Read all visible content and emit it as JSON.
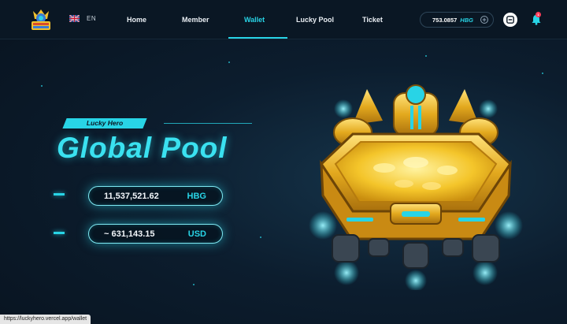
{
  "nav": {
    "language": {
      "label": "EN",
      "flag_icon": "uk-flag-icon"
    },
    "links": [
      {
        "label": "Home",
        "active": false
      },
      {
        "label": "Member",
        "active": false
      },
      {
        "label": "Wallet",
        "active": true
      },
      {
        "label": "Lucky Pool",
        "active": false
      },
      {
        "label": "Ticket",
        "active": false
      }
    ],
    "balance": {
      "amount": "753.0857",
      "unit": "HBG",
      "add_icon": "plus-circle-icon"
    },
    "scan_icon": "scan-icon",
    "notification": {
      "icon": "bell-icon",
      "badge": "1"
    }
  },
  "hero": {
    "tag": "Lucky Hero",
    "title": "Global Pool",
    "pool_hbg": {
      "value": "11,537,521.62",
      "unit": "HBG"
    },
    "pool_usd": {
      "value": "~ 631,143.15",
      "unit": "USD"
    }
  },
  "status_bar": {
    "url": "https://luckyhero.vercel.app/wallet"
  },
  "colors": {
    "accent": "#28d4e6",
    "background": "#0c1d2e",
    "gold": "#f2c12e"
  }
}
